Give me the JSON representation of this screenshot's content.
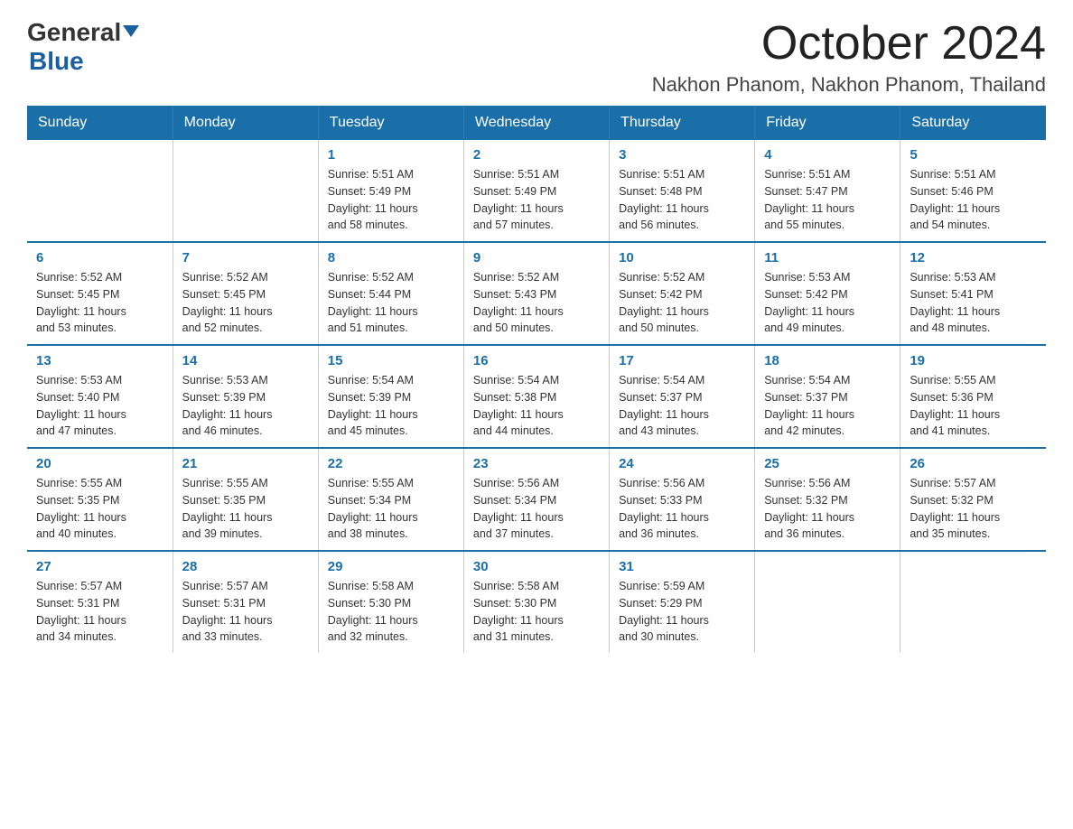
{
  "header": {
    "logo_general": "General",
    "logo_blue": "Blue",
    "main_title": "October 2024",
    "subtitle": "Nakhon Phanom, Nakhon Phanom, Thailand"
  },
  "calendar": {
    "headers": [
      "Sunday",
      "Monday",
      "Tuesday",
      "Wednesday",
      "Thursday",
      "Friday",
      "Saturday"
    ],
    "weeks": [
      [
        {
          "day": "",
          "info": ""
        },
        {
          "day": "",
          "info": ""
        },
        {
          "day": "1",
          "info": "Sunrise: 5:51 AM\nSunset: 5:49 PM\nDaylight: 11 hours\nand 58 minutes."
        },
        {
          "day": "2",
          "info": "Sunrise: 5:51 AM\nSunset: 5:49 PM\nDaylight: 11 hours\nand 57 minutes."
        },
        {
          "day": "3",
          "info": "Sunrise: 5:51 AM\nSunset: 5:48 PM\nDaylight: 11 hours\nand 56 minutes."
        },
        {
          "day": "4",
          "info": "Sunrise: 5:51 AM\nSunset: 5:47 PM\nDaylight: 11 hours\nand 55 minutes."
        },
        {
          "day": "5",
          "info": "Sunrise: 5:51 AM\nSunset: 5:46 PM\nDaylight: 11 hours\nand 54 minutes."
        }
      ],
      [
        {
          "day": "6",
          "info": "Sunrise: 5:52 AM\nSunset: 5:45 PM\nDaylight: 11 hours\nand 53 minutes."
        },
        {
          "day": "7",
          "info": "Sunrise: 5:52 AM\nSunset: 5:45 PM\nDaylight: 11 hours\nand 52 minutes."
        },
        {
          "day": "8",
          "info": "Sunrise: 5:52 AM\nSunset: 5:44 PM\nDaylight: 11 hours\nand 51 minutes."
        },
        {
          "day": "9",
          "info": "Sunrise: 5:52 AM\nSunset: 5:43 PM\nDaylight: 11 hours\nand 50 minutes."
        },
        {
          "day": "10",
          "info": "Sunrise: 5:52 AM\nSunset: 5:42 PM\nDaylight: 11 hours\nand 50 minutes."
        },
        {
          "day": "11",
          "info": "Sunrise: 5:53 AM\nSunset: 5:42 PM\nDaylight: 11 hours\nand 49 minutes."
        },
        {
          "day": "12",
          "info": "Sunrise: 5:53 AM\nSunset: 5:41 PM\nDaylight: 11 hours\nand 48 minutes."
        }
      ],
      [
        {
          "day": "13",
          "info": "Sunrise: 5:53 AM\nSunset: 5:40 PM\nDaylight: 11 hours\nand 47 minutes."
        },
        {
          "day": "14",
          "info": "Sunrise: 5:53 AM\nSunset: 5:39 PM\nDaylight: 11 hours\nand 46 minutes."
        },
        {
          "day": "15",
          "info": "Sunrise: 5:54 AM\nSunset: 5:39 PM\nDaylight: 11 hours\nand 45 minutes."
        },
        {
          "day": "16",
          "info": "Sunrise: 5:54 AM\nSunset: 5:38 PM\nDaylight: 11 hours\nand 44 minutes."
        },
        {
          "day": "17",
          "info": "Sunrise: 5:54 AM\nSunset: 5:37 PM\nDaylight: 11 hours\nand 43 minutes."
        },
        {
          "day": "18",
          "info": "Sunrise: 5:54 AM\nSunset: 5:37 PM\nDaylight: 11 hours\nand 42 minutes."
        },
        {
          "day": "19",
          "info": "Sunrise: 5:55 AM\nSunset: 5:36 PM\nDaylight: 11 hours\nand 41 minutes."
        }
      ],
      [
        {
          "day": "20",
          "info": "Sunrise: 5:55 AM\nSunset: 5:35 PM\nDaylight: 11 hours\nand 40 minutes."
        },
        {
          "day": "21",
          "info": "Sunrise: 5:55 AM\nSunset: 5:35 PM\nDaylight: 11 hours\nand 39 minutes."
        },
        {
          "day": "22",
          "info": "Sunrise: 5:55 AM\nSunset: 5:34 PM\nDaylight: 11 hours\nand 38 minutes."
        },
        {
          "day": "23",
          "info": "Sunrise: 5:56 AM\nSunset: 5:34 PM\nDaylight: 11 hours\nand 37 minutes."
        },
        {
          "day": "24",
          "info": "Sunrise: 5:56 AM\nSunset: 5:33 PM\nDaylight: 11 hours\nand 36 minutes."
        },
        {
          "day": "25",
          "info": "Sunrise: 5:56 AM\nSunset: 5:32 PM\nDaylight: 11 hours\nand 36 minutes."
        },
        {
          "day": "26",
          "info": "Sunrise: 5:57 AM\nSunset: 5:32 PM\nDaylight: 11 hours\nand 35 minutes."
        }
      ],
      [
        {
          "day": "27",
          "info": "Sunrise: 5:57 AM\nSunset: 5:31 PM\nDaylight: 11 hours\nand 34 minutes."
        },
        {
          "day": "28",
          "info": "Sunrise: 5:57 AM\nSunset: 5:31 PM\nDaylight: 11 hours\nand 33 minutes."
        },
        {
          "day": "29",
          "info": "Sunrise: 5:58 AM\nSunset: 5:30 PM\nDaylight: 11 hours\nand 32 minutes."
        },
        {
          "day": "30",
          "info": "Sunrise: 5:58 AM\nSunset: 5:30 PM\nDaylight: 11 hours\nand 31 minutes."
        },
        {
          "day": "31",
          "info": "Sunrise: 5:59 AM\nSunset: 5:29 PM\nDaylight: 11 hours\nand 30 minutes."
        },
        {
          "day": "",
          "info": ""
        },
        {
          "day": "",
          "info": ""
        }
      ]
    ]
  }
}
